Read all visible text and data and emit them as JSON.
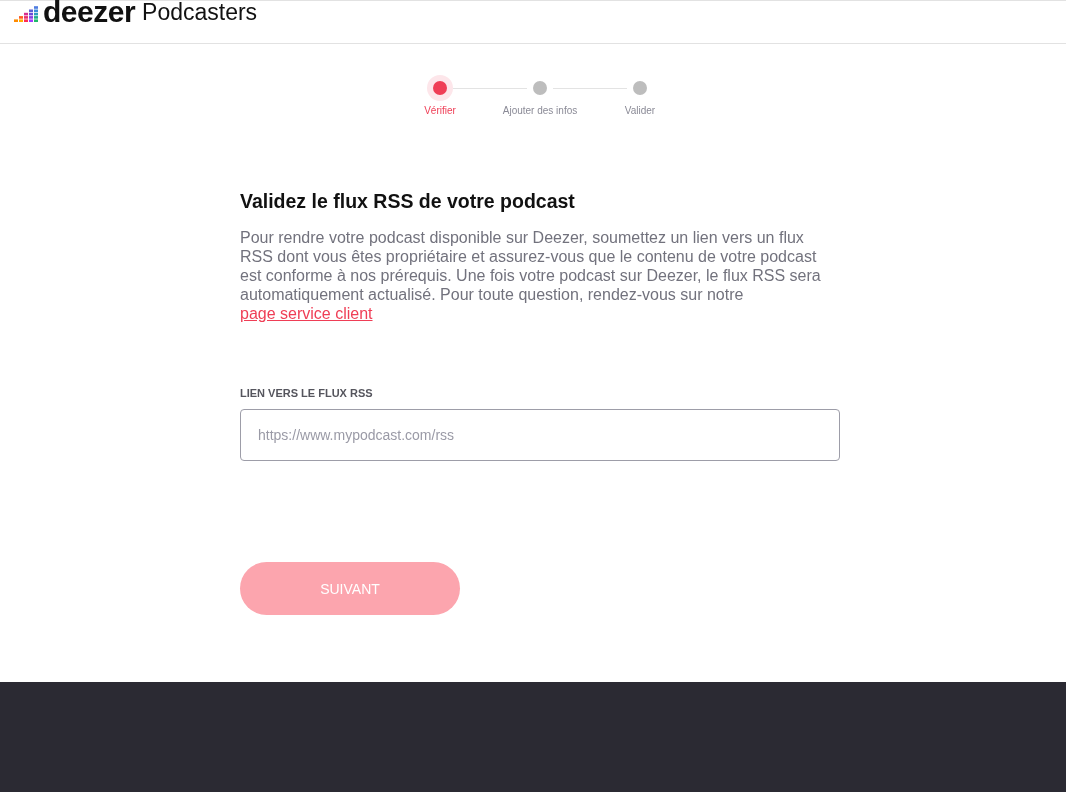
{
  "header": {
    "logo_text": "deezer",
    "title": "Podcasters"
  },
  "stepper": [
    {
      "label": "Vérifier",
      "selected": true
    },
    {
      "label": "Ajouter des infos",
      "selected": false
    },
    {
      "label": "Valider",
      "selected": false
    }
  ],
  "form": {
    "heading": "Validez le flux RSS de votre podcast",
    "description": "Pour rendre votre podcast disponible sur Deezer, soumettez un lien vers un flux RSS dont vous êtes propriétaire et assurez-vous que le contenu de votre podcast est conforme à nos prérequis. Une fois votre podcast sur Deezer, le flux RSS sera automatiquement actualisé. Pour toute question, rendez-vous sur notre",
    "link": "page service client",
    "field": {
      "label": "LIEN VERS LE FLUX RSS",
      "placeholder": "https://www.mypodcast.com/rss"
    },
    "button": {
      "label": "SUIVANT",
      "disabled": true
    }
  }
}
